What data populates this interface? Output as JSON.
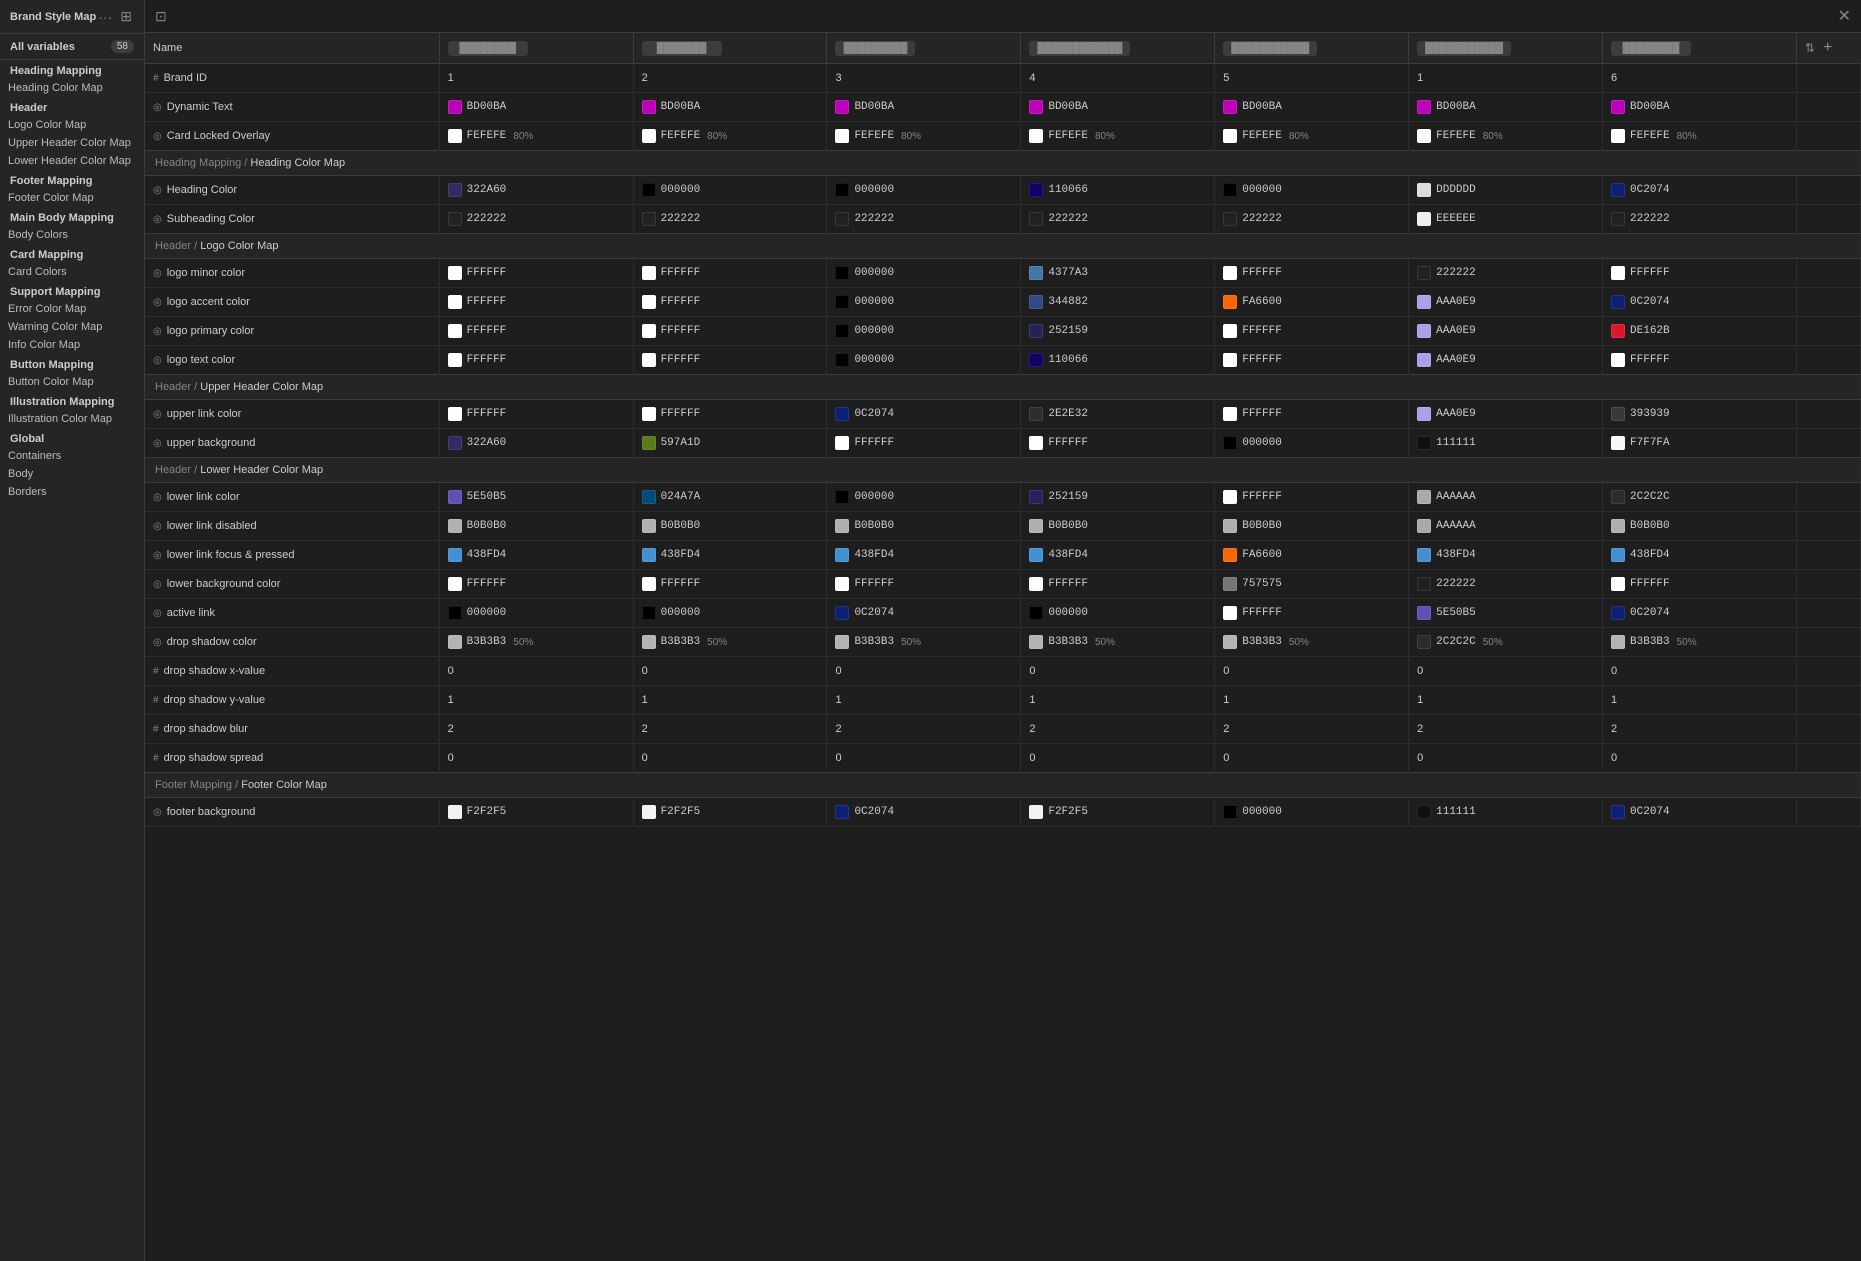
{
  "sidebar": {
    "title": "Brand Style Map",
    "allVars": {
      "label": "All variables",
      "count": "58"
    },
    "groups": [
      {
        "label": "Heading Mapping",
        "items": [
          "Heading Color Map"
        ]
      },
      {
        "label": "Header",
        "items": [
          "Logo Color Map",
          "Upper Header Color Map",
          "Lower Header Color Map"
        ]
      },
      {
        "label": "Footer Mapping",
        "items": [
          "Footer Color Map"
        ]
      },
      {
        "label": "Main Body Mapping",
        "items": [
          "Body Colors"
        ]
      },
      {
        "label": "Card Mapping",
        "items": [
          "Card Colors"
        ]
      },
      {
        "label": "Support Mapping",
        "items": [
          "Error Color Map",
          "Warning Color Map",
          "Info Color Map"
        ]
      },
      {
        "label": "Button Mapping",
        "items": [
          "Button Color Map"
        ]
      },
      {
        "label": "Illustration Mapping",
        "items": [
          "Illustration Color Map"
        ]
      },
      {
        "label": "Global",
        "items": [
          "Containers",
          "Body",
          "Borders"
        ]
      }
    ]
  },
  "table": {
    "addColLabel": "+",
    "filterLabel": "⇅",
    "columns": [
      {
        "id": "name",
        "label": "Name"
      },
      {
        "id": "b1",
        "label": ""
      },
      {
        "id": "b2",
        "label": ""
      },
      {
        "id": "b3",
        "label": ""
      },
      {
        "id": "b4",
        "label": ""
      },
      {
        "id": "b5",
        "label": ""
      },
      {
        "id": "b6",
        "label": ""
      },
      {
        "id": "b7",
        "label": ""
      }
    ],
    "brandIds": [
      "1",
      "2",
      "3",
      "4",
      "5",
      "1",
      "6"
    ],
    "sections": [
      {
        "path": "Heading Mapping /",
        "name": "Heading Color Map",
        "rows": [
          {
            "type": "circle",
            "name": "Heading Color",
            "values": [
              {
                "color": "#322A60",
                "text": "322A60"
              },
              {
                "color": "#000000",
                "text": "000000"
              },
              {
                "color": "#000000",
                "text": "000000"
              },
              {
                "color": "#110066",
                "text": "110066"
              },
              {
                "color": "#000000",
                "text": "000000"
              },
              {
                "color": "#DDDDDD",
                "text": "DDDDDD"
              },
              {
                "color": "#0C2074",
                "text": "0C2074"
              }
            ]
          },
          {
            "type": "circle",
            "name": "Subheading Color",
            "values": [
              {
                "color": "#222222",
                "text": "222222"
              },
              {
                "color": "#222222",
                "text": "222222"
              },
              {
                "color": "#222222",
                "text": "222222"
              },
              {
                "color": "#222222",
                "text": "222222"
              },
              {
                "color": "#222222",
                "text": "222222"
              },
              {
                "color": "#EEEEEE",
                "text": "EEEEEE"
              },
              {
                "color": "#222222",
                "text": "222222"
              }
            ]
          }
        ]
      },
      {
        "path": "Header /",
        "name": "Logo Color Map",
        "rows": [
          {
            "type": "circle",
            "name": "logo minor color",
            "values": [
              {
                "color": "#FFFFFF",
                "text": "FFFFFF"
              },
              {
                "color": "#FFFFFF",
                "text": "FFFFFF"
              },
              {
                "color": "#000000",
                "text": "000000"
              },
              {
                "color": "#4377A3",
                "text": "4377A3"
              },
              {
                "color": "#FFFFFF",
                "text": "FFFFFF"
              },
              {
                "color": "#222222",
                "text": "222222"
              },
              {
                "color": "#FFFFFF",
                "text": "FFFFFF"
              }
            ]
          },
          {
            "type": "circle",
            "name": "logo accent color",
            "values": [
              {
                "color": "#FFFFFF",
                "text": "FFFFFF"
              },
              {
                "color": "#FFFFFF",
                "text": "FFFFFF"
              },
              {
                "color": "#000000",
                "text": "000000"
              },
              {
                "color": "#344882",
                "text": "344882"
              },
              {
                "color": "#FA6600",
                "text": "FA6600"
              },
              {
                "color": "#AAA0E9",
                "text": "AAA0E9"
              },
              {
                "color": "#0C2074",
                "text": "0C2074"
              }
            ]
          },
          {
            "type": "circle",
            "name": "logo primary color",
            "values": [
              {
                "color": "#FFFFFF",
                "text": "FFFFFF"
              },
              {
                "color": "#FFFFFF",
                "text": "FFFFFF"
              },
              {
                "color": "#000000",
                "text": "000000"
              },
              {
                "color": "#252159",
                "text": "252159"
              },
              {
                "color": "#FFFFFF",
                "text": "FFFFFF"
              },
              {
                "color": "#AAA0E9",
                "text": "AAA0E9"
              },
              {
                "color": "#DE162B",
                "text": "DE162B"
              }
            ]
          },
          {
            "type": "circle",
            "name": "logo text color",
            "values": [
              {
                "color": "#FFFFFF",
                "text": "FFFFFF"
              },
              {
                "color": "#FFFFFF",
                "text": "FFFFFF"
              },
              {
                "color": "#000000",
                "text": "000000"
              },
              {
                "color": "#110066",
                "text": "110066"
              },
              {
                "color": "#FFFFFF",
                "text": "FFFFFF"
              },
              {
                "color": "#AAA0E9",
                "text": "AAA0E9"
              },
              {
                "color": "#FFFFFF",
                "text": "FFFFFF"
              }
            ]
          }
        ]
      },
      {
        "path": "Header /",
        "name": "Upper Header Color Map",
        "rows": [
          {
            "type": "circle",
            "name": "upper link color",
            "values": [
              {
                "color": "#FFFFFF",
                "text": "FFFFFF"
              },
              {
                "color": "#FFFFFF",
                "text": "FFFFFF"
              },
              {
                "color": "#0C2074",
                "text": "0C2074"
              },
              {
                "color": "#2E2E32",
                "text": "2E2E32"
              },
              {
                "color": "#FFFFFF",
                "text": "FFFFFF"
              },
              {
                "color": "#AAA0E9",
                "text": "AAA0E9"
              },
              {
                "color": "#393939",
                "text": "393939"
              }
            ]
          },
          {
            "type": "circle",
            "name": "upper background",
            "values": [
              {
                "color": "#322A60",
                "text": "322A60"
              },
              {
                "color": "#597A1D",
                "text": "597A1D"
              },
              {
                "color": "#FFFFFF",
                "text": "FFFFFF"
              },
              {
                "color": "#FFFFFF",
                "text": "FFFFFF"
              },
              {
                "color": "#000000",
                "text": "000000"
              },
              {
                "color": "#111111",
                "text": "111111"
              },
              {
                "color": "#F7F7FA",
                "text": "F7F7FA"
              }
            ]
          }
        ]
      },
      {
        "path": "Header /",
        "name": "Lower Header Color Map",
        "rows": [
          {
            "type": "circle",
            "name": "lower link color",
            "values": [
              {
                "color": "#5E50B5",
                "text": "5E50B5"
              },
              {
                "color": "#024A7A",
                "text": "024A7A"
              },
              {
                "color": "#000000",
                "text": "000000"
              },
              {
                "color": "#252159",
                "text": "252159"
              },
              {
                "color": "#FFFFFF",
                "text": "FFFFFF"
              },
              {
                "color": "#AAAAAA",
                "text": "AAAAAA"
              },
              {
                "color": "#2C2C2C",
                "text": "2C2C2C"
              }
            ]
          },
          {
            "type": "circle",
            "name": "lower link disabled",
            "values": [
              {
                "color": "#B0B0B0",
                "text": "B0B0B0"
              },
              {
                "color": "#B0B0B0",
                "text": "B0B0B0"
              },
              {
                "color": "#B0B0B0",
                "text": "B0B0B0"
              },
              {
                "color": "#B0B0B0",
                "text": "B0B0B0"
              },
              {
                "color": "#B0B0B0",
                "text": "B0B0B0"
              },
              {
                "color": "#AAAAAA",
                "text": "AAAAAA"
              },
              {
                "color": "#B0B0B0",
                "text": "B0B0B0"
              }
            ]
          },
          {
            "type": "circle",
            "name": "lower link focus & pressed",
            "values": [
              {
                "color": "#438FD4",
                "text": "438FD4"
              },
              {
                "color": "#438FD4",
                "text": "438FD4"
              },
              {
                "color": "#438FD4",
                "text": "438FD4"
              },
              {
                "color": "#438FD4",
                "text": "438FD4"
              },
              {
                "color": "#FA6600",
                "text": "FA6600"
              },
              {
                "color": "#438FD4",
                "text": "438FD4"
              },
              {
                "color": "#438FD4",
                "text": "438FD4"
              }
            ]
          },
          {
            "type": "circle",
            "name": "lower background color",
            "values": [
              {
                "color": "#FFFFFF",
                "text": "FFFFFF"
              },
              {
                "color": "#FFFFFF",
                "text": "FFFFFF"
              },
              {
                "color": "#FFFFFF",
                "text": "FFFFFF"
              },
              {
                "color": "#FFFFFF",
                "text": "FFFFFF"
              },
              {
                "color": "#757575",
                "text": "757575"
              },
              {
                "color": "#222222",
                "text": "222222"
              },
              {
                "color": "#FFFFFF",
                "text": "FFFFFF"
              }
            ]
          },
          {
            "type": "circle",
            "name": "active link",
            "values": [
              {
                "color": "#000000",
                "text": "000000"
              },
              {
                "color": "#000000",
                "text": "000000"
              },
              {
                "color": "#0C2074",
                "text": "0C2074"
              },
              {
                "color": "#000000",
                "text": "000000"
              },
              {
                "color": "#FFFFFF",
                "text": "FFFFFF"
              },
              {
                "color": "#5E50B5",
                "text": "5E50B5"
              },
              {
                "color": "#0C2074",
                "text": "0C2074"
              }
            ]
          },
          {
            "type": "circle",
            "name": "drop shadow color",
            "opacity": "50%",
            "values": [
              {
                "color": "#B3B3B3",
                "text": "B3B3B3"
              },
              {
                "color": "#B3B3B3",
                "text": "B3B3B3"
              },
              {
                "color": "#B3B3B3",
                "text": "B3B3B3"
              },
              {
                "color": "#B3B3B3",
                "text": "B3B3B3"
              },
              {
                "color": "#B3B3B3",
                "text": "B3B3B3"
              },
              {
                "color": "#2C2C2C",
                "text": "2C2C2C"
              },
              {
                "color": "#B3B3B3",
                "text": "B3B3B3"
              }
            ]
          },
          {
            "type": "hash",
            "name": "drop shadow x-value",
            "values": [
              {
                "number": "0"
              },
              {
                "number": "0"
              },
              {
                "number": "0"
              },
              {
                "number": "0"
              },
              {
                "number": "0"
              },
              {
                "number": "0"
              },
              {
                "number": "0"
              }
            ]
          },
          {
            "type": "hash",
            "name": "drop shadow y-value",
            "values": [
              {
                "number": "1"
              },
              {
                "number": "1"
              },
              {
                "number": "1"
              },
              {
                "number": "1"
              },
              {
                "number": "1"
              },
              {
                "number": "1"
              },
              {
                "number": "1"
              }
            ]
          },
          {
            "type": "hash",
            "name": "drop shadow blur",
            "values": [
              {
                "number": "2"
              },
              {
                "number": "2"
              },
              {
                "number": "2"
              },
              {
                "number": "2"
              },
              {
                "number": "2"
              },
              {
                "number": "2"
              },
              {
                "number": "2"
              }
            ]
          },
          {
            "type": "hash",
            "name": "drop shadow spread",
            "values": [
              {
                "number": "0"
              },
              {
                "number": "0"
              },
              {
                "number": "0"
              },
              {
                "number": "0"
              },
              {
                "number": "0"
              },
              {
                "number": "0"
              },
              {
                "number": "0"
              }
            ]
          }
        ]
      },
      {
        "path": "Footer Mapping /",
        "name": "Footer Color Map",
        "rows": [
          {
            "type": "circle",
            "name": "footer background",
            "values": [
              {
                "color": "#F2F2F5",
                "text": "F2F2F5"
              },
              {
                "color": "#F2F2F5",
                "text": "F2F2F5"
              },
              {
                "color": "#0C2074",
                "text": "0C2074"
              },
              {
                "color": "#F2F2F5",
                "text": "F2F2F5"
              },
              {
                "color": "#000000",
                "text": "000000"
              },
              {
                "color": "#111111",
                "text": "111111"
              },
              {
                "color": "#0C2074",
                "text": "0C2074"
              }
            ]
          }
        ]
      }
    ],
    "topRows": [
      {
        "type": "hash",
        "name": "Brand ID",
        "values": [
          {
            "number": "1"
          },
          {
            "number": "2"
          },
          {
            "number": "3"
          },
          {
            "number": "4"
          },
          {
            "number": "5"
          },
          {
            "number": "1"
          },
          {
            "number": "6"
          }
        ]
      },
      {
        "type": "circle",
        "name": "Dynamic Text",
        "values": [
          {
            "color": "#BD00BA",
            "text": "BD00BA"
          },
          {
            "color": "#BD00BA",
            "text": "BD00BA"
          },
          {
            "color": "#BD00BA",
            "text": "BD00BA"
          },
          {
            "color": "#BD00BA",
            "text": "BD00BA"
          },
          {
            "color": "#BD00BA",
            "text": "BD00BA"
          },
          {
            "color": "#BD00BA",
            "text": "BD00BA"
          },
          {
            "color": "#BD00BA",
            "text": "BD00BA"
          }
        ]
      },
      {
        "type": "circle",
        "name": "Card Locked Overlay",
        "opacity": "80%",
        "values": [
          {
            "color": "#FEFEFE",
            "text": "FEFEFE"
          },
          {
            "color": "#FEFEFE",
            "text": "FEFEFE"
          },
          {
            "color": "#FEFEFE",
            "text": "FEFEFE"
          },
          {
            "color": "#FEFEFE",
            "text": "FEFEFE"
          },
          {
            "color": "#FEFEFE",
            "text": "FEFEFE"
          },
          {
            "color": "#FEFEFE",
            "text": "FEFEFE"
          },
          {
            "color": "#FEFEFE",
            "text": "FEFEFE"
          }
        ]
      }
    ]
  }
}
